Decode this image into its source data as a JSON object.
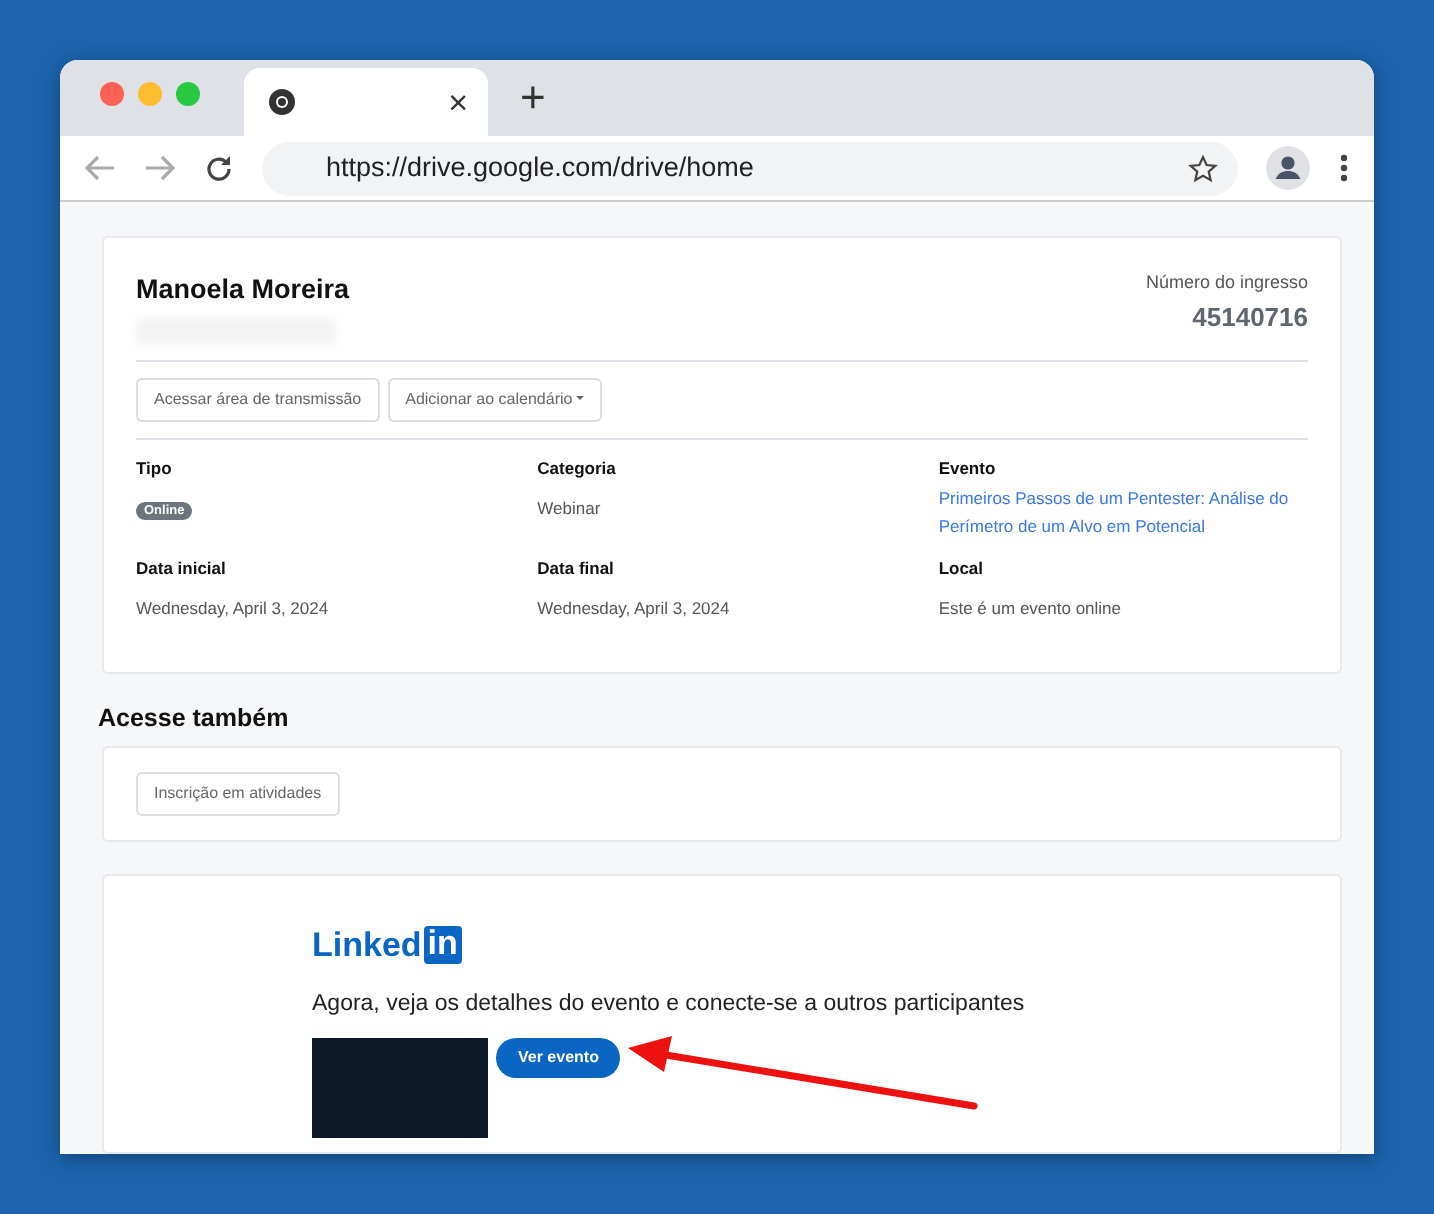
{
  "browser": {
    "tab_close": "×",
    "new_tab": "+",
    "url": "https://drive.google.com/drive/home"
  },
  "ticket": {
    "name": "Manoela Moreira",
    "number_label": "Número do ingresso",
    "number": "45140716",
    "actions": [
      {
        "label": "Acessar área de transmissão",
        "kind": "button"
      },
      {
        "label": "Adicionar ao calendário",
        "kind": "dropdown"
      }
    ],
    "fields": [
      {
        "label": "Tipo",
        "kind": "badge",
        "value": "Online"
      },
      {
        "label": "Categoria",
        "kind": "text",
        "value": "Webinar"
      },
      {
        "label": "Evento",
        "kind": "link",
        "value": "Primeiros Passos de um Pentester: Análise do Perímetro de um Alvo em Potencial"
      },
      {
        "label": "Data inicial",
        "kind": "text",
        "value": "Wednesday, April 3, 2024"
      },
      {
        "label": "Data final",
        "kind": "text",
        "value": "Wednesday, April 3, 2024"
      },
      {
        "label": "Local",
        "kind": "text",
        "value": "Este é um evento online"
      }
    ]
  },
  "also": {
    "title": "Acesse também",
    "buttons": [
      "Inscrição em atividades"
    ]
  },
  "linkedin": {
    "logo_text": "Linked",
    "logo_box": "in",
    "message": "Agora, veja os detalhes do evento e conecte-se a outros participantes",
    "button": "Ver evento"
  }
}
